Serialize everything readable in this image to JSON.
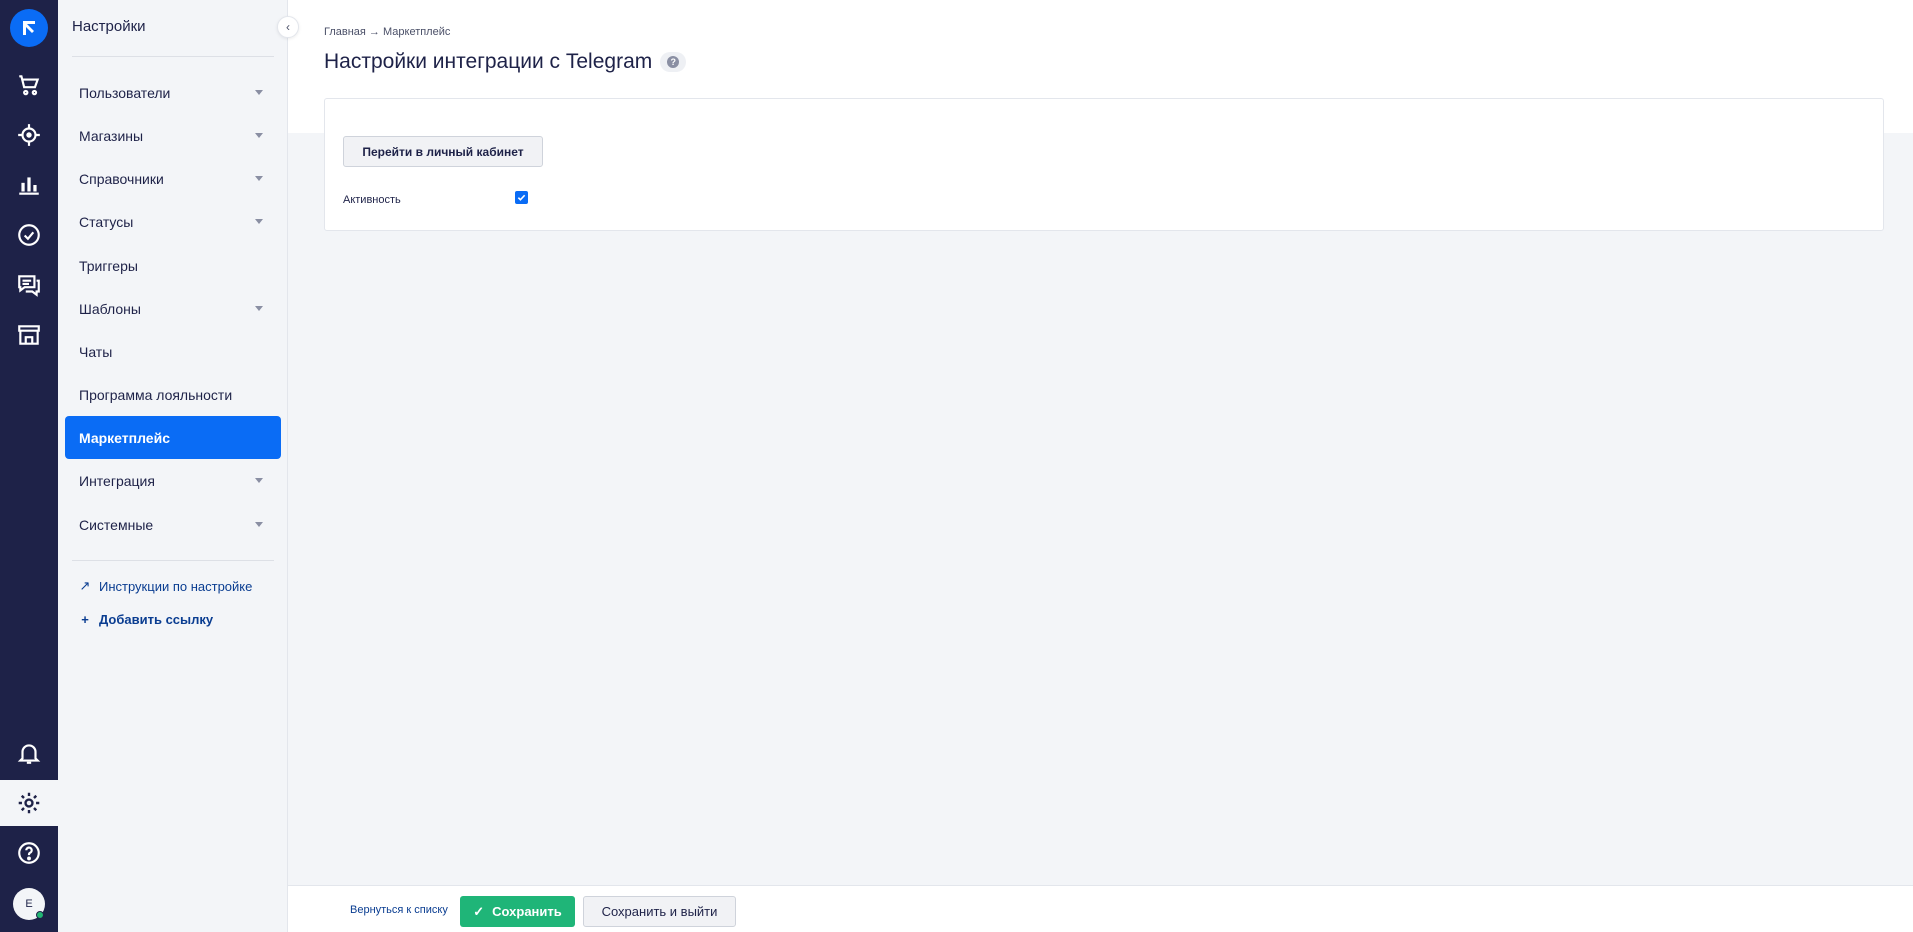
{
  "sidebar": {
    "title": "Настройки",
    "items": [
      {
        "label": "Пользователи"
      },
      {
        "label": "Магазины"
      },
      {
        "label": "Справочники"
      },
      {
        "label": "Статусы"
      },
      {
        "label": "Триггеры"
      },
      {
        "label": "Шаблоны"
      },
      {
        "label": "Чаты"
      },
      {
        "label": "Программа лояльности"
      },
      {
        "label": "Маркетплейс"
      },
      {
        "label": "Интеграция"
      },
      {
        "label": "Системные"
      }
    ],
    "links": [
      {
        "label": "Инструкции по настройке"
      },
      {
        "label": "Добавить ссылку"
      }
    ]
  },
  "rail": {
    "avatar_letter": "E",
    "colors": {
      "rail_bg": "#1e2248",
      "accent": "#0a6cf5",
      "online": "#22b573"
    }
  },
  "header": {
    "breadcrumb": "Главная → Маркетплейс",
    "title": "Настройки интеграции с Telegram",
    "help": "?"
  },
  "card": {
    "cabinet_button": "Перейти в личный кабинет",
    "activity_label": "Активность",
    "activity_checked": true
  },
  "footer": {
    "back_link": "Вернуться к списку",
    "save_button": "Сохранить",
    "save_exit_button": "Сохранить и выйти",
    "save_color": "#1fb578"
  }
}
